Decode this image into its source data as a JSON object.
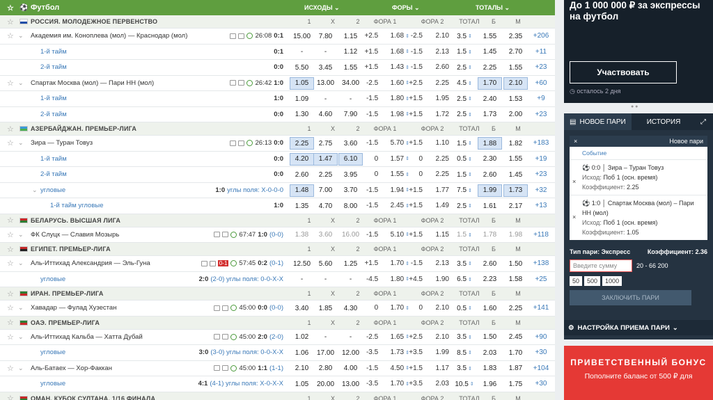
{
  "header": {
    "title": "Футбол",
    "col_outcomes": "ИСХОДЫ",
    "col_fora": "ФОРЫ",
    "col_fora2": "ФОРА 2",
    "col_totals": "ТОТАЛЫ"
  },
  "league_cols": {
    "c1": "1",
    "cx": "X",
    "c2": "2",
    "f1": "ФОРА 1",
    "f2": "ФОРА 2",
    "tot": "ТОТАЛ",
    "b": "Б",
    "m": "М"
  },
  "rows": [
    {
      "type": "league",
      "name": "РОССИЯ. МОЛОДЕЖНОЕ ПЕРВЕНСТВО",
      "flag": "#fff",
      "flag2": "#1e4fa8"
    },
    {
      "type": "match",
      "name": "Академия им. Коноплева (мол) — Краснодар (мол)",
      "time": "26:08",
      "score": "0:1",
      "o": [
        "15.00",
        "7.80",
        "1.15"
      ],
      "f1": [
        "+2.5",
        "1.68"
      ],
      "f2": [
        "-2.5",
        "2.10"
      ],
      "t": [
        "3.5",
        "1.55",
        "2.35"
      ],
      "cnt": "+206"
    },
    {
      "type": "sub",
      "label": "1-й тайм",
      "score": "0:1",
      "o": [
        "-",
        "-",
        "1.12"
      ],
      "f1": [
        "+1.5",
        "1.68"
      ],
      "f2": [
        "-1.5",
        "2.13"
      ],
      "t": [
        "1.5",
        "1.45",
        "2.70"
      ],
      "cnt": "+11"
    },
    {
      "type": "sub",
      "label": "2-й тайм",
      "score": "0:0",
      "o": [
        "5.50",
        "3.45",
        "1.55"
      ],
      "f1": [
        "+1.5",
        "1.43"
      ],
      "f2": [
        "-1.5",
        "2.60"
      ],
      "t": [
        "2.5",
        "2.25",
        "1.55"
      ],
      "cnt": "+23"
    },
    {
      "type": "match",
      "name": "Спартак Москва (мол) — Пари НН (мол)",
      "time": "26:42",
      "score": "1:0",
      "o": [
        "1.05",
        "13.00",
        "34.00"
      ],
      "f1": [
        "-2.5",
        "1.60"
      ],
      "f2": [
        "+2.5",
        "2.25"
      ],
      "t": [
        "4.5",
        "1.70",
        "2.10"
      ],
      "cnt": "+60",
      "sel": [
        0,
        5,
        6
      ]
    },
    {
      "type": "sub",
      "label": "1-й тайм",
      "score": "1:0",
      "o": [
        "1.09",
        "-",
        "-"
      ],
      "f1": [
        "-1.5",
        "1.80"
      ],
      "f2": [
        "+1.5",
        "1.95"
      ],
      "t": [
        "2.5",
        "2.40",
        "1.53"
      ],
      "cnt": "+9"
    },
    {
      "type": "sub",
      "label": "2-й тайм",
      "score": "0:0",
      "o": [
        "1.30",
        "4.60",
        "7.90"
      ],
      "f1": [
        "-1.5",
        "1.98"
      ],
      "f2": [
        "+1.5",
        "1.72"
      ],
      "t": [
        "2.5",
        "1.73",
        "2.00"
      ],
      "cnt": "+23"
    },
    {
      "type": "league",
      "name": "АЗЕРБАЙДЖАН. ПРЕМЬЕР-ЛИГА",
      "flag": "#3a9bd6",
      "flag2": "#4caf50"
    },
    {
      "type": "match",
      "name": "Зира — Туран Товуз",
      "time": "26:13",
      "score": "0:0",
      "o": [
        "2.25",
        "2.75",
        "3.60"
      ],
      "f1": [
        "-1.5",
        "5.70"
      ],
      "f2": [
        "+1.5",
        "1.10"
      ],
      "t": [
        "1.5",
        "1.88",
        "1.82"
      ],
      "cnt": "+183",
      "sel": [
        0,
        5
      ]
    },
    {
      "type": "sub",
      "label": "1-й тайм",
      "score": "0:0",
      "o": [
        "4.20",
        "1.47",
        "6.10"
      ],
      "f1": [
        "0",
        "1.57"
      ],
      "f2": [
        "0",
        "2.25"
      ],
      "t": [
        "0.5",
        "2.30",
        "1.55"
      ],
      "cnt": "+19",
      "sel": [
        0,
        1,
        2
      ]
    },
    {
      "type": "sub",
      "label": "2-й тайм",
      "score": "0:0",
      "o": [
        "2.60",
        "2.25",
        "3.95"
      ],
      "f1": [
        "0",
        "1.55"
      ],
      "f2": [
        "0",
        "2.25"
      ],
      "t": [
        "1.5",
        "2.60",
        "1.45"
      ],
      "cnt": "+23"
    },
    {
      "type": "corner",
      "label": "угловые",
      "score": "1:0",
      "extra": "углы поля: Х-0-0-0",
      "o": [
        "1.48",
        "7.00",
        "3.70"
      ],
      "f1": [
        "-1.5",
        "1.94"
      ],
      "f2": [
        "+1.5",
        "1.77"
      ],
      "t": [
        "7.5",
        "1.99",
        "1.73"
      ],
      "cnt": "+32",
      "sel": [
        0,
        4,
        5,
        6
      ]
    },
    {
      "type": "sub2",
      "label": "1-й тайм угловые",
      "score": "1:0",
      "o": [
        "1.35",
        "4.70",
        "8.00"
      ],
      "f1": [
        "-1.5",
        "2.45"
      ],
      "f2": [
        "+1.5",
        "1.49"
      ],
      "t": [
        "2.5",
        "1.61",
        "2.17"
      ],
      "cnt": "+13"
    },
    {
      "type": "league",
      "name": "БЕЛАРУСЬ. ВЫСШАЯ ЛИГА",
      "flag": "#c62828",
      "flag2": "#2e7d32"
    },
    {
      "type": "match",
      "name": "ФК Слуцк — Славия Мозырь",
      "time": "67:47",
      "score": "1:0",
      "extra": "(0-0)",
      "o": [
        "1.38",
        "3.60",
        "16.00"
      ],
      "f1": [
        "-1.5",
        "5.10"
      ],
      "f2": [
        "+1.5",
        "1.15"
      ],
      "t": [
        "1.5",
        "1.78",
        "1.98"
      ],
      "cnt": "+118",
      "dim": true
    },
    {
      "type": "league",
      "name": "ЕГИПЕТ. ПРЕМЬЕР-ЛИГА",
      "flag": "#c62828",
      "flag2": "#222"
    },
    {
      "type": "match",
      "name": "Аль-Иттихад Александрия — Эль-Гуна",
      "time": "57:45",
      "score": "0:2",
      "extra": "(0-1)",
      "red": "0-1",
      "o": [
        "12.50",
        "5.60",
        "1.25"
      ],
      "f1": [
        "+1.5",
        "1.70"
      ],
      "f2": [
        "-1.5",
        "2.13"
      ],
      "t": [
        "3.5",
        "2.60",
        "1.50"
      ],
      "cnt": "+138"
    },
    {
      "type": "corner",
      "label": "угловые",
      "score": "2:0",
      "extra": "(2-0) углы поля: 0-0-Х-Х",
      "o": [
        "-",
        "-",
        "-"
      ],
      "f1": [
        "-4.5",
        "1.80"
      ],
      "f2": [
        "+4.5",
        "1.90"
      ],
      "t": [
        "6.5",
        "2.23",
        "1.58"
      ],
      "cnt": "+25"
    },
    {
      "type": "league",
      "name": "ИРАН. ПРЕМЬЕР-ЛИГА",
      "flag": "#2e7d32",
      "flag2": "#c62828"
    },
    {
      "type": "match",
      "name": "Хавадар — Фулад Хузестан",
      "time": "45:00",
      "score": "0:0",
      "extra": "(0-0)",
      "o": [
        "3.40",
        "1.85",
        "4.30"
      ],
      "f1": [
        "0",
        "1.70"
      ],
      "f2": [
        "0",
        "2.10"
      ],
      "t": [
        "0.5",
        "1.60",
        "2.25"
      ],
      "cnt": "+141"
    },
    {
      "type": "league",
      "name": "ОАЭ. ПРЕМЬЕР-ЛИГА",
      "flag": "#2e7d32",
      "flag2": "#c62828"
    },
    {
      "type": "match",
      "name": "Аль-Иттихад Кальба — Хатта Дубай",
      "time": "45:00",
      "score": "2:0",
      "extra": "(2-0)",
      "o": [
        "1.02",
        "-",
        "-"
      ],
      "f1": [
        "-2.5",
        "1.65"
      ],
      "f2": [
        "+2.5",
        "2.10"
      ],
      "t": [
        "3.5",
        "1.50",
        "2.45"
      ],
      "cnt": "+90"
    },
    {
      "type": "corner",
      "label": "угловые",
      "score": "3:0",
      "extra": "(3-0) углы поля: 0-0-Х-Х",
      "o": [
        "1.06",
        "17.00",
        "12.00"
      ],
      "f1": [
        "-3.5",
        "1.73"
      ],
      "f2": [
        "+3.5",
        "1.99"
      ],
      "t": [
        "8.5",
        "2.03",
        "1.70"
      ],
      "cnt": "+30"
    },
    {
      "type": "match",
      "name": "Аль-Батаех — Хор-Факкан",
      "time": "45:00",
      "score": "1:1",
      "extra": "(1-1)",
      "o": [
        "2.10",
        "2.80",
        "4.00"
      ],
      "f1": [
        "-1.5",
        "4.50"
      ],
      "f2": [
        "+1.5",
        "1.17"
      ],
      "t": [
        "3.5",
        "1.83",
        "1.87"
      ],
      "cnt": "+104"
    },
    {
      "type": "corner",
      "label": "угловые",
      "score": "4:1",
      "extra": "(4-1) углы поля: Х-0-Х-Х",
      "o": [
        "1.05",
        "20.00",
        "13.00"
      ],
      "f1": [
        "-3.5",
        "1.70"
      ],
      "f2": [
        "+3.5",
        "2.03"
      ],
      "t": [
        "10.5",
        "1.96",
        "1.75"
      ],
      "cnt": "+30"
    },
    {
      "type": "league",
      "name": "ОМАН. КУБОК СУЛТАНА. 1/16 ФИНАЛА",
      "flag": "#c62828",
      "flag2": "#2e7d32"
    }
  ],
  "promo1": {
    "title": "До 1 000 000 ₽ за экспрессы на футбол",
    "button": "Участвовать",
    "footer": "осталось 2 дня"
  },
  "slip": {
    "tab_new": "НОВОЕ ПАРИ",
    "tab_history": "ИСТОРИЯ",
    "new_bet": "Новое пари",
    "event_label": "Событие",
    "bets": [
      {
        "score": "0:0",
        "match": "Зира – Туран Товуз",
        "outcome_label": "Исход:",
        "outcome": "Поб 1 (осн. время)",
        "coef_label": "Коэффициент:",
        "coef": "2.25"
      },
      {
        "score": "1:0",
        "match": "Спартак Москва (мол) – Пари НН (мол)",
        "outcome_label": "Исход:",
        "outcome": "Поб 1 (осн. время)",
        "coef_label": "Коэффициент:",
        "coef": "1.05"
      }
    ],
    "type_label": "Тип пари: Экспресс",
    "total_coef_label": "Коэффициент:",
    "total_coef": "2.36",
    "amount_placeholder": "Введите сумму",
    "range": "20 - 66 200",
    "quick": [
      "50",
      "500",
      "1000"
    ],
    "place": "ЗАКЛЮЧИТЬ ПАРИ",
    "settings": "НАСТРОЙКА ПРИЕМА ПАРИ"
  },
  "promo2": {
    "title": "ПРИВЕТСТВЕННЫЙ БОНУС",
    "text": "Пополните баланс от 500 ₽ для"
  }
}
